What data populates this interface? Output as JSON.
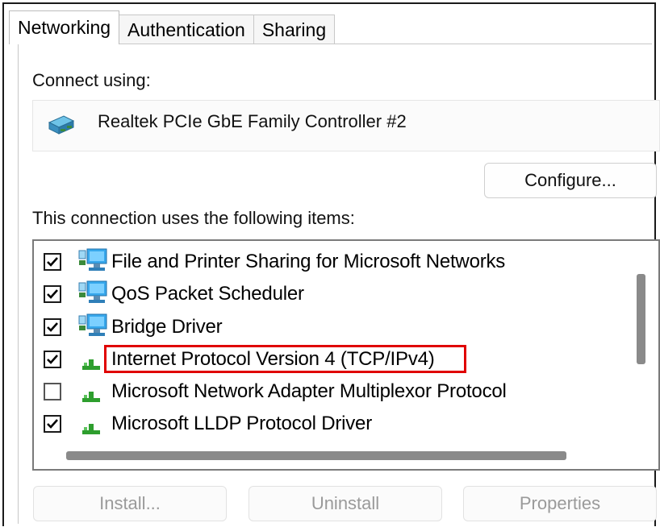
{
  "tabs": [
    {
      "label": "Networking",
      "active": true
    },
    {
      "label": "Authentication",
      "active": false
    },
    {
      "label": "Sharing",
      "active": false
    }
  ],
  "connect_using_label": "Connect using:",
  "adapter": {
    "name": "Realtek PCIe GbE Family Controller #2",
    "icon": "network-adapter-icon"
  },
  "configure_label": "Configure...",
  "items_label": "This connection uses the following items:",
  "items": [
    {
      "label": "File and Printer Sharing for Microsoft Networks",
      "checked": true,
      "icon": "network-service-icon"
    },
    {
      "label": "QoS Packet Scheduler",
      "checked": true,
      "icon": "network-service-icon"
    },
    {
      "label": "Bridge Driver",
      "checked": true,
      "icon": "network-service-icon"
    },
    {
      "label": "Internet Protocol Version 4 (TCP/IPv4)",
      "checked": true,
      "icon": "protocol-icon",
      "highlighted": true
    },
    {
      "label": "Microsoft Network Adapter Multiplexor Protocol",
      "checked": false,
      "icon": "protocol-icon"
    },
    {
      "label": "Microsoft LLDP Protocol Driver",
      "checked": true,
      "icon": "protocol-icon"
    }
  ],
  "buttons": {
    "install": "Install...",
    "uninstall": "Uninstall",
    "properties": "Properties"
  },
  "colors": {
    "highlight": "#e00000",
    "protocol_green": "#2e9e2e",
    "service_blue": "#1e90d8"
  }
}
